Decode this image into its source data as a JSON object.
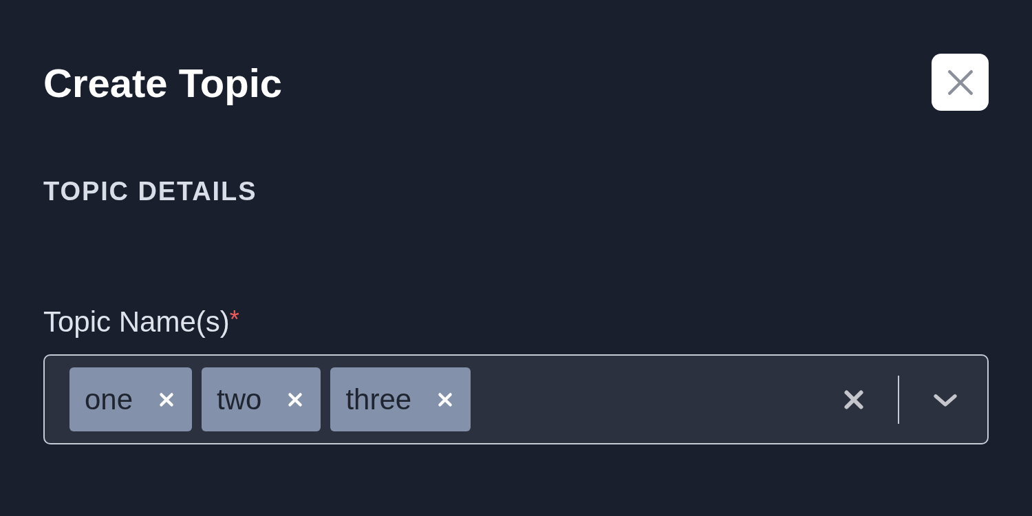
{
  "dialog": {
    "title": "Create Topic"
  },
  "section": {
    "title": "TOPIC DETAILS"
  },
  "field": {
    "label": "Topic Name(s)",
    "required_mark": "*",
    "chips": [
      {
        "label": "one"
      },
      {
        "label": "two"
      },
      {
        "label": "three"
      }
    ]
  }
}
